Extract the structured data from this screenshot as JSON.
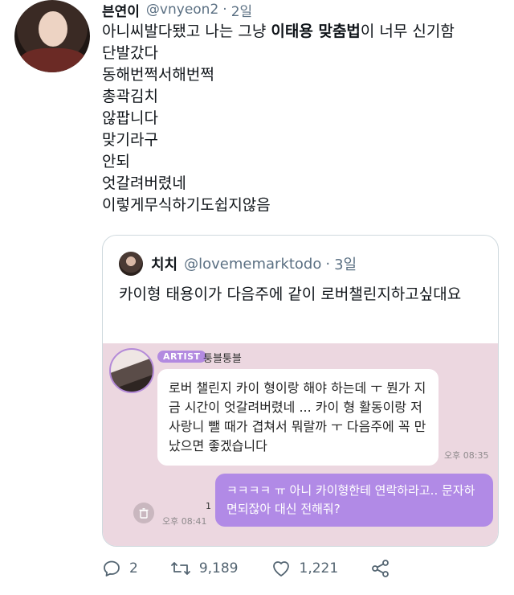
{
  "tweet": {
    "author_name": "븐연이",
    "author_handle": "@vnyeon2",
    "separator": "·",
    "time": "2일",
    "lines": [
      {
        "pre": "아니씨발다됐고 나는 그냥 ",
        "bold": "이태용 맞춤법",
        "post": "이 너무 신기함"
      },
      {
        "pre": "단발갔다"
      },
      {
        "pre": "동해번쩍서해번쩍"
      },
      {
        "pre": "총곽김치"
      },
      {
        "pre": "않팝니다"
      },
      {
        "pre": "맞기라구"
      },
      {
        "pre": "안되"
      },
      {
        "pre": "엇갈려버렸네"
      },
      {
        "pre": "이렇게무식하기도쉽지않음"
      }
    ]
  },
  "quote": {
    "author_name": "치치",
    "author_handle": "@lovememarktodo",
    "separator": "·",
    "time": "3일",
    "text": "카이형 태용이가 다음주에 같이 로버챌린지하고싶대요",
    "chat": {
      "badge": "ARTIST",
      "artist_name": "퉁블퉁블",
      "incoming_message": "로버 챌린지 카이 형이랑 해야 하는데 ㅜ 뭔가 지금 시간이 엇갈려버렸네 ... 카이 형 활동이랑 저 사랑니 뺄 때가 겹쳐서 뭐랄까 ㅜ 다음주에 꼭 만났으면 좋겠습니다",
      "incoming_time": "오후 08:35",
      "outgoing_message": "ㅋㅋㅋㅋ ㅠ 아니 카이형한테 연락하라고.. 문자하면되잖아 대신 전해줘?",
      "unread_count": "1",
      "outgoing_time": "오후 08:41"
    }
  },
  "actions": {
    "replies": "2",
    "retweets": "9,189",
    "likes": "1,221"
  }
}
